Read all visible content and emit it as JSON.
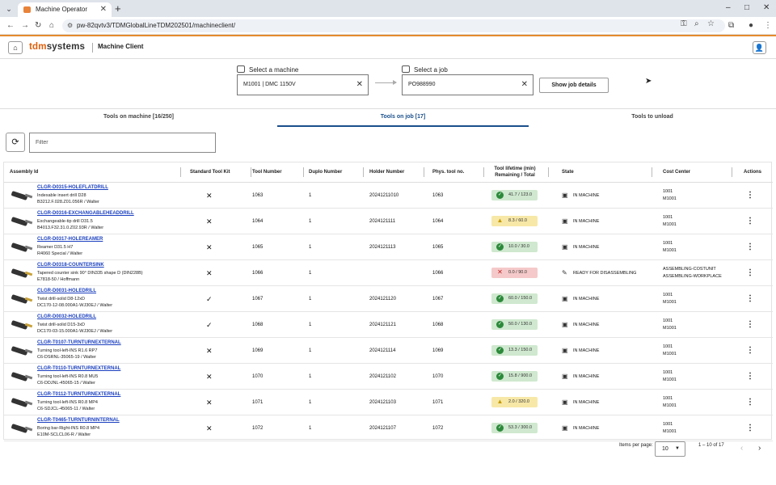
{
  "browser": {
    "tab_title": "Machine Operator",
    "url": "pw-82qvtv3/TDMGlobalLineTDM202501/machineclient/"
  },
  "app": {
    "logo_part1": "tdm",
    "logo_part2": "systems",
    "title": "Machine Client",
    "brand_color": "#e0600b"
  },
  "selectors": {
    "machine_label": "Select a machine",
    "machine_value": "M1001 | DMC 1150V",
    "job_label": "Select a job",
    "job_value": "PO988990",
    "show_job_details": "Show job details"
  },
  "tabs": [
    {
      "label": "Tools on machine [16/250]",
      "active": false
    },
    {
      "label": "Tools on job [17]",
      "active": true
    },
    {
      "label": "Tools to unload",
      "active": false
    }
  ],
  "filter": {
    "placeholder": "Filter"
  },
  "table": {
    "headers": {
      "assembly_id": "Assembly Id",
      "standard_tool_kit": "Standard Tool Kit",
      "tool_number": "Tool Number",
      "duplo_number": "Duplo Number",
      "holder_number": "Holder Number",
      "phys_tool_no": "Phys. tool no.",
      "tool_lifetime_1": "Tool lifetime (min)",
      "tool_lifetime_2": "Remaining / Total",
      "state": "State",
      "cost_center": "Cost Center",
      "actions": "Actions"
    },
    "rows": [
      {
        "id": "CLGR-D0315-HOLEFLATDRILL",
        "d1": "Indexable insert drill D28",
        "d2": "B3212.F.028.Z01.056R / Walter",
        "kit": "✕",
        "tool": "1063",
        "duplo": "1",
        "holder": "20241211010",
        "phys": "1063",
        "life": "41.7 / 123.0",
        "life_status": "ok",
        "state": "IN MACHINE",
        "cc1": "1001",
        "cc2": "M1001",
        "tip": "grey"
      },
      {
        "id": "CLGR-D0316-EXCHANGABLEHEADDRILL",
        "d1": "Exchangeable-tip drill D31.5",
        "d2": "B4013.F32.31.0.Z02.93R / Walter",
        "kit": "✕",
        "tool": "1064",
        "duplo": "1",
        "holder": "2024121111",
        "phys": "1064",
        "life": "8.3 / 60.0",
        "life_status": "warn",
        "state": "IN MACHINE",
        "cc1": "1001",
        "cc2": "M1001",
        "tip": "grey"
      },
      {
        "id": "CLGR-D0317-HOLEREAMER",
        "d1": "Reamer D31.5 H7",
        "d2": "R4060 Special / Walter",
        "kit": "✕",
        "tool": "1065",
        "duplo": "1",
        "holder": "2024121113",
        "phys": "1065",
        "life": "10.0 / 30.0",
        "life_status": "ok",
        "state": "IN MACHINE",
        "cc1": "1001",
        "cc2": "M1001",
        "tip": "grey"
      },
      {
        "id": "CLGR-D0318-COUNTERSINK",
        "d1": "Tapered counter sink 90° DIN335 shape D (DIN228B)",
        "d2": "E7818-50 / Hoffmann",
        "kit": "✕",
        "tool": "1066",
        "duplo": "1",
        "holder": "",
        "phys": "1066",
        "life": "0.0 / 90.0",
        "life_status": "bad",
        "state": "READY FOR DISASSEMBLING",
        "cc1": "ASSEMBLING-COSTUNIT",
        "cc2": "ASSEMBLING-WORKPLACE",
        "tip": "gold"
      },
      {
        "id": "CLGR-D0031-HOLEDRILL",
        "d1": "Twist drill-solid D8-12xD",
        "d2": "DC170-12-08.000A1-WJ30EJ / Walter",
        "kit": "✓",
        "tool": "1067",
        "duplo": "1",
        "holder": "2024121120",
        "phys": "1067",
        "life": "60.0 / 150.0",
        "life_status": "ok",
        "state": "IN MACHINE",
        "cc1": "1001",
        "cc2": "M1001",
        "tip": "gold"
      },
      {
        "id": "CLGR-D0032-HOLEDRILL",
        "d1": "Twist drill-solid D15-3xD",
        "d2": "DC170-03-15.000A1-WJ30EJ / Walter",
        "kit": "✓",
        "tool": "1068",
        "duplo": "1",
        "holder": "2024121121",
        "phys": "1068",
        "life": "50.0 / 130.0",
        "life_status": "ok",
        "state": "IN MACHINE",
        "cc1": "1001",
        "cc2": "M1001",
        "tip": "gold"
      },
      {
        "id": "CLGR-T0107-TURNTURNEXTERNAL",
        "d1": "Turning tool-left-INS R1.6 RP7",
        "d2": "C6-DSRNL-35065-19 / Walter",
        "kit": "✕",
        "tool": "1069",
        "duplo": "1",
        "holder": "2024121114",
        "phys": "1069",
        "life": "13.3 / 150.0",
        "life_status": "ok",
        "state": "IN MACHINE",
        "cc1": "1001",
        "cc2": "M1001",
        "tip": "grey"
      },
      {
        "id": "CLGR-T0110-TURNTURNEXTERNAL",
        "d1": "Turning tool-left-INS R0.8 MU5",
        "d2": "C6-DDJNL-45065-15 / Walter",
        "kit": "✕",
        "tool": "1070",
        "duplo": "1",
        "holder": "2024121102",
        "phys": "1070",
        "life": "15.8 / 900.0",
        "life_status": "ok",
        "state": "IN MACHINE",
        "cc1": "1001",
        "cc2": "M1001",
        "tip": "grey"
      },
      {
        "id": "CLGR-T0112-TURNTURNEXTERNAL",
        "d1": "Turning tool-left-INS R0.8 MP4",
        "d2": "C6-SDJCL-45065-11 / Walter",
        "kit": "✕",
        "tool": "1071",
        "duplo": "1",
        "holder": "2024121103",
        "phys": "1071",
        "life": "2.0 / 320.0",
        "life_status": "warn",
        "state": "IN MACHINE",
        "cc1": "1001",
        "cc2": "M1001",
        "tip": "grey"
      },
      {
        "id": "CLGR-T0465-TURNTURNINTERNAL",
        "d1": "Boring bar-Right-INS R0.8 MP4",
        "d2": "E10M-SCLCL06-R / Walter",
        "kit": "✕",
        "tool": "1072",
        "duplo": "1",
        "holder": "2024121107",
        "phys": "1072",
        "life": "53.3 / 300.0",
        "life_status": "ok",
        "state": "IN MACHINE",
        "cc1": "1001",
        "cc2": "M1001",
        "tip": "grey"
      }
    ]
  },
  "pagination": {
    "items_per_page_label": "Items per page:",
    "items_per_page": "10",
    "range": "1 – 10 of 17"
  }
}
